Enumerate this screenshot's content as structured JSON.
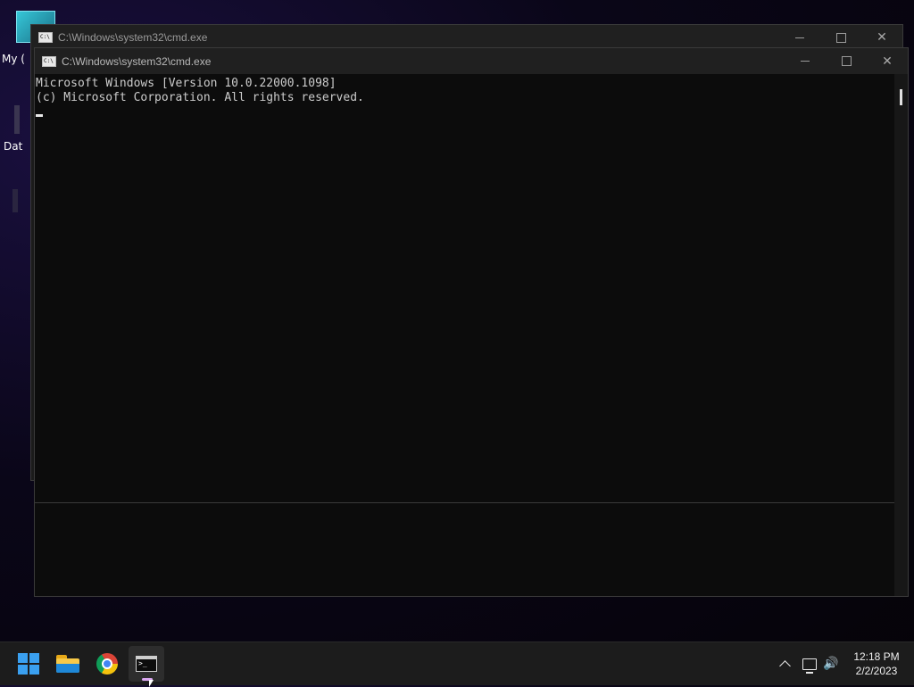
{
  "desktop": {
    "icon_label_1": "My (",
    "icon_label_2": "Dat"
  },
  "back_window": {
    "title": "C:\\Windows\\system32\\cmd.exe"
  },
  "front_window": {
    "title": "C:\\Windows\\system32\\cmd.exe",
    "console_lines": [
      "Microsoft Windows [Version 10.0.22000.1098]",
      "(c) Microsoft Corporation. All rights reserved."
    ]
  },
  "taskbar": {
    "apps": [
      {
        "name": "start",
        "icon": "windows-logo-icon"
      },
      {
        "name": "file-explorer",
        "icon": "folder-icon"
      },
      {
        "name": "chrome",
        "icon": "chrome-icon"
      },
      {
        "name": "command-prompt",
        "icon": "cmd-icon",
        "active": true
      }
    ],
    "tray_icons": [
      "chevron-up-icon",
      "network-icon",
      "volume-icon"
    ]
  },
  "clock": {
    "time": "12:18 PM",
    "date": "2/2/2023"
  },
  "colors": {
    "start_blue": "#3aa0f0",
    "active_indicator": "#d9a6f0",
    "console_bg": "#0c0c0c",
    "console_fg": "#cccccc"
  }
}
